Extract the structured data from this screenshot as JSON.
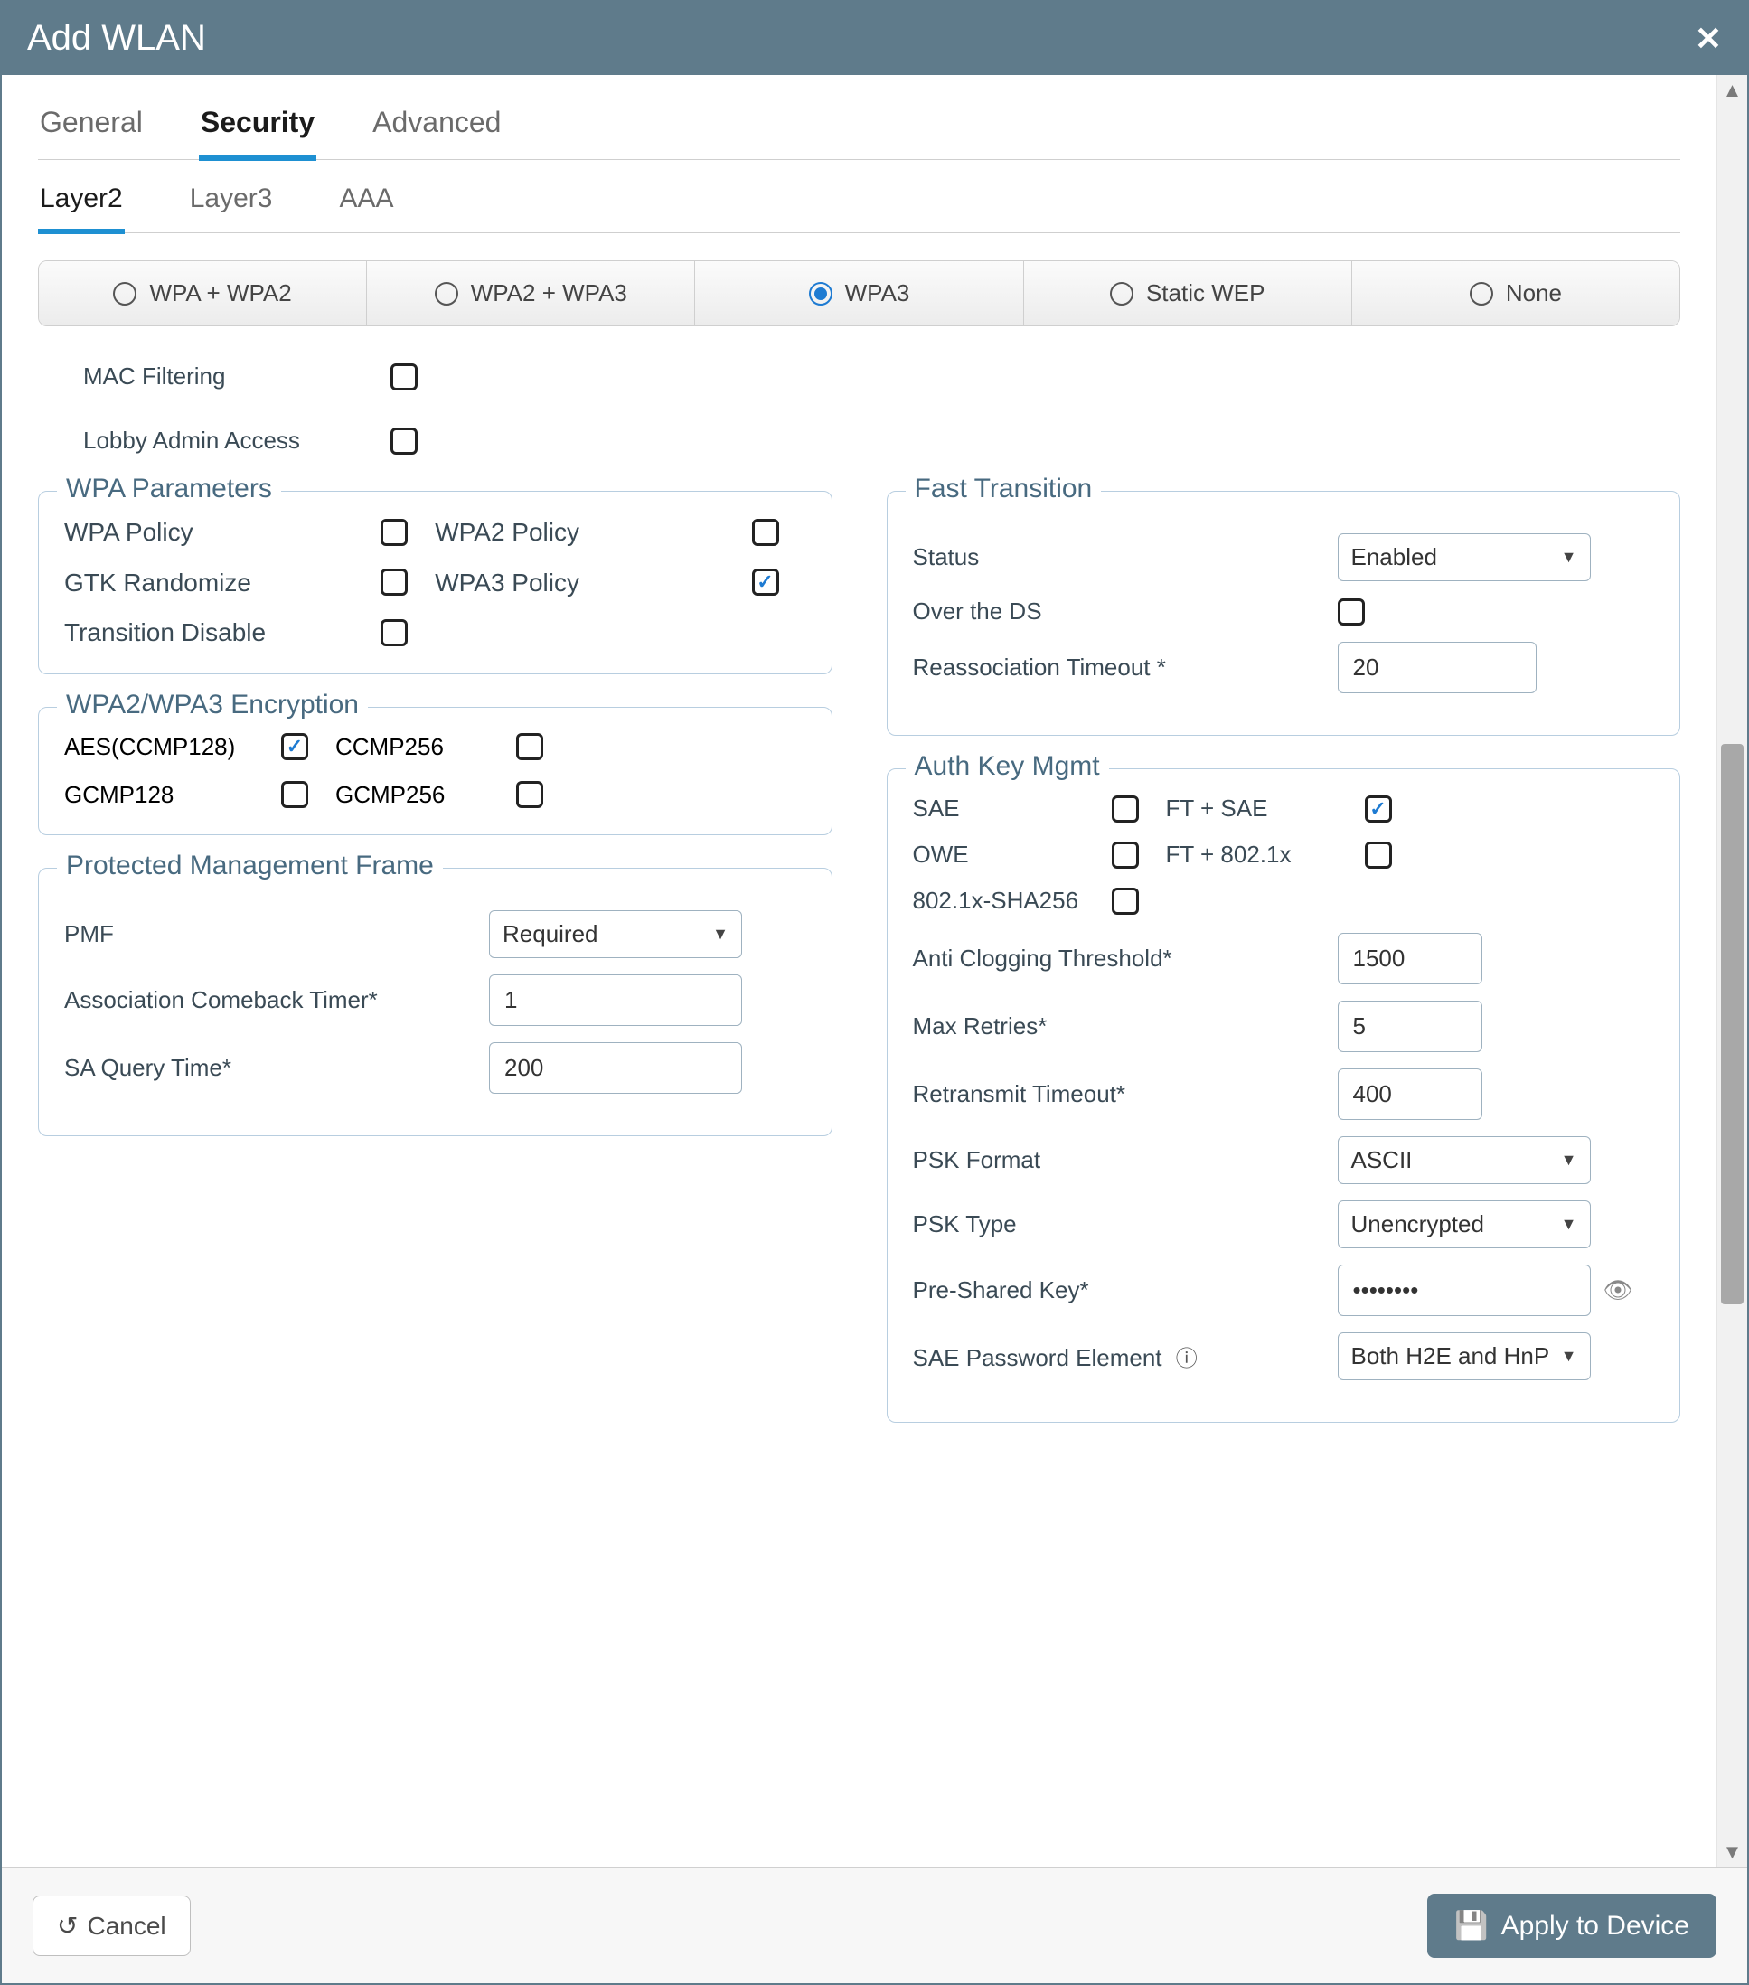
{
  "title": "Add WLAN",
  "tabs": {
    "general": "General",
    "security": "Security",
    "advanced": "Advanced",
    "active": "security"
  },
  "subtabs": {
    "layer2": "Layer2",
    "layer3": "Layer3",
    "aaa": "AAA",
    "active": "layer2"
  },
  "security_modes": {
    "wpa_wpa2": "WPA + WPA2",
    "wpa2_wpa3": "WPA2 + WPA3",
    "wpa3": "WPA3",
    "static_wep": "Static WEP",
    "none": "None",
    "selected": "wpa3"
  },
  "mac_filtering": {
    "label": "MAC Filtering",
    "checked": false
  },
  "lobby_admin": {
    "label": "Lobby Admin Access",
    "checked": false
  },
  "wpa_params": {
    "legend": "WPA Parameters",
    "wpa_policy": {
      "label": "WPA Policy",
      "checked": false
    },
    "wpa2_policy": {
      "label": "WPA2 Policy",
      "checked": false
    },
    "gtk_randomize": {
      "label": "GTK Randomize",
      "checked": false
    },
    "wpa3_policy": {
      "label": "WPA3 Policy",
      "checked": true
    },
    "transition_disable": {
      "label": "Transition Disable",
      "checked": false
    }
  },
  "encryption": {
    "legend": "WPA2/WPA3 Encryption",
    "aes_ccmp128": {
      "label": "AES(CCMP128)",
      "checked": true
    },
    "ccmp256": {
      "label": "CCMP256",
      "checked": false
    },
    "gcmp128": {
      "label": "GCMP128",
      "checked": false
    },
    "gcmp256": {
      "label": "GCMP256",
      "checked": false
    }
  },
  "pmf": {
    "legend": "Protected Management Frame",
    "pmf_label": "PMF",
    "pmf_value": "Required",
    "assoc_label": "Association Comeback Timer*",
    "assoc_value": "1",
    "sa_label": "SA Query Time*",
    "sa_value": "200"
  },
  "ft": {
    "legend": "Fast Transition",
    "status_label": "Status",
    "status_value": "Enabled",
    "over_ds": {
      "label": "Over the DS",
      "checked": false
    },
    "reassoc_label": "Reassociation Timeout *",
    "reassoc_value": "20"
  },
  "akm": {
    "legend": "Auth Key Mgmt",
    "sae": {
      "label": "SAE",
      "checked": false
    },
    "ft_sae": {
      "label": "FT + SAE",
      "checked": true
    },
    "owe": {
      "label": "OWE",
      "checked": false
    },
    "ft_8021x": {
      "label": "FT + 802.1x",
      "checked": false
    },
    "sha256": {
      "label": "802.1x-SHA256",
      "checked": false
    },
    "anti_clog_label": "Anti Clogging Threshold*",
    "anti_clog_value": "1500",
    "max_retries_label": "Max Retries*",
    "max_retries_value": "5",
    "retransmit_label": "Retransmit Timeout*",
    "retransmit_value": "400",
    "psk_format_label": "PSK Format",
    "psk_format_value": "ASCII",
    "psk_type_label": "PSK Type",
    "psk_type_value": "Unencrypted",
    "psk_label": "Pre-Shared Key*",
    "psk_value": "••••••••",
    "sae_pwe_label": "SAE Password Element",
    "sae_pwe_value": "Both H2E and HnP"
  },
  "footer": {
    "cancel": "Cancel",
    "apply": "Apply to Device"
  }
}
